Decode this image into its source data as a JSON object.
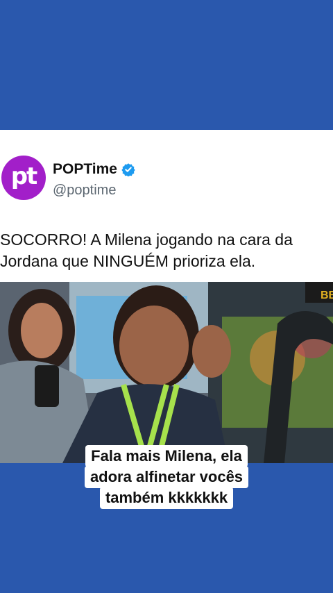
{
  "tweet": {
    "avatar_text": "pt",
    "display_name": "POPTime",
    "handle": "@poptime",
    "text": "SOCORRO! A Milena jogando na cara da Jordana que NINGUÉM prioriza ela."
  },
  "caption": {
    "lines": [
      "Fala mais Milena, ela",
      "adora alfinetar vocês",
      "também kkkkkkk"
    ]
  },
  "colors": {
    "background": "#2a58ad",
    "avatar": "#a21fc9",
    "verified": "#1d9bf0"
  }
}
